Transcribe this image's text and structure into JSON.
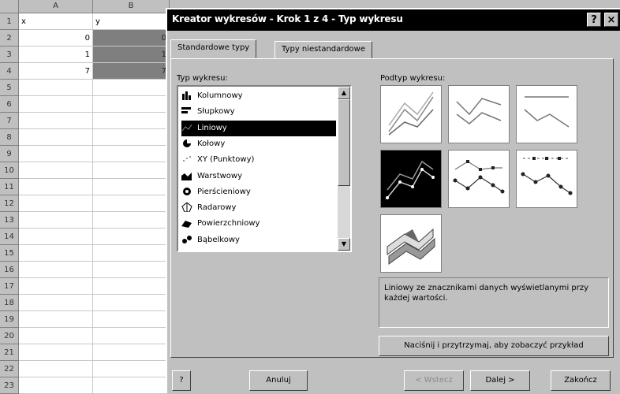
{
  "sheet": {
    "col_headers": [
      "A",
      "B"
    ],
    "row_numbers": [
      "1",
      "2",
      "3",
      "4",
      "5",
      "6",
      "7",
      "8",
      "9",
      "10",
      "11",
      "12",
      "13",
      "14",
      "15",
      "16",
      "17",
      "18",
      "19",
      "20",
      "21",
      "22",
      "23"
    ],
    "rows": [
      {
        "a": "x",
        "b": "y"
      },
      {
        "a": "0",
        "b": "0"
      },
      {
        "a": "1",
        "b": "1"
      },
      {
        "a": "7",
        "b": "7"
      }
    ]
  },
  "dialog": {
    "title": "Kreator wykresów - Krok 1 z 4 - Typ wykresu",
    "help_btn": "?",
    "close_btn": "×",
    "tabs": [
      "Standardowe typy",
      "Typy niestandardowe"
    ],
    "type_label": "Typ wykresu:",
    "subtype_label": "Podtyp wykresu:",
    "types": [
      {
        "label": "Kolumnowy",
        "icon": "column-chart-icon"
      },
      {
        "label": "Słupkowy",
        "icon": "bar-chart-icon"
      },
      {
        "label": "Liniowy",
        "icon": "line-chart-icon"
      },
      {
        "label": "Kołowy",
        "icon": "pie-chart-icon"
      },
      {
        "label": "XY (Punktowy)",
        "icon": "scatter-chart-icon"
      },
      {
        "label": "Warstwowy",
        "icon": "area-chart-icon"
      },
      {
        "label": "Pierścieniowy",
        "icon": "doughnut-chart-icon"
      },
      {
        "label": "Radarowy",
        "icon": "radar-chart-icon"
      },
      {
        "label": "Powierzchniowy",
        "icon": "surface-chart-icon"
      },
      {
        "label": "Bąbelkowy",
        "icon": "bubble-chart-icon"
      }
    ],
    "selected_type": "Liniowy",
    "description": "Liniowy ze znacznikami danych wyświetlanymi przy każdej wartości.",
    "preview_button": "Naciśnij i przytrzymaj, aby zobaczyć przykład",
    "buttons": {
      "help": "?",
      "cancel": "Anuluj",
      "back": "< Wstecz",
      "next": "Dalej >",
      "finish": "Zakończ"
    }
  }
}
